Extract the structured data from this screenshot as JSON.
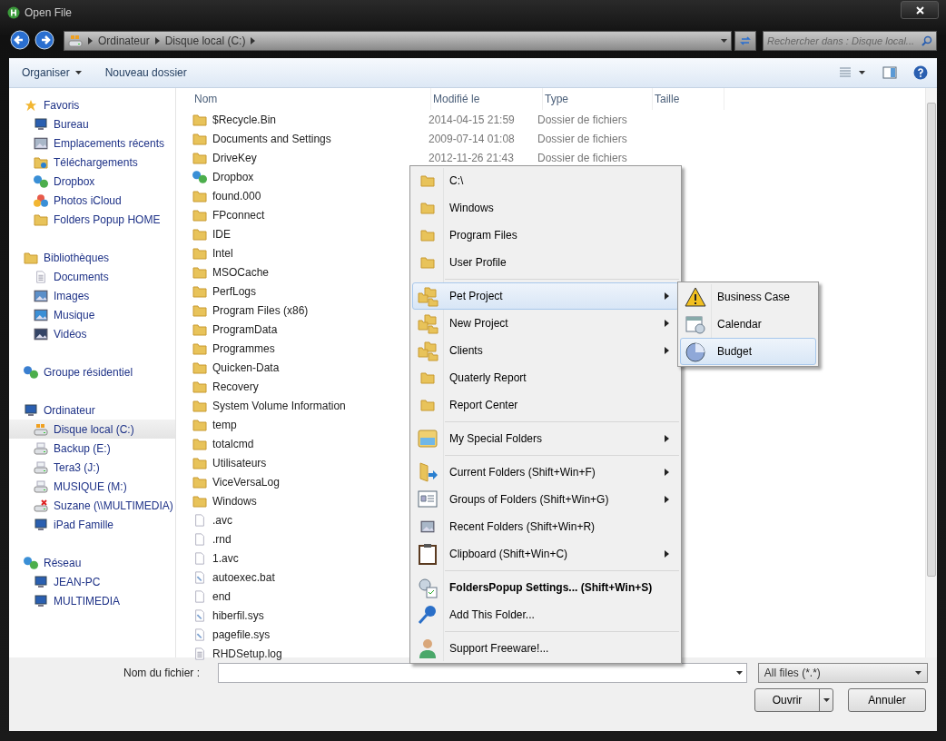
{
  "window": {
    "title": "Open File"
  },
  "address_bar": {
    "crumbs": [
      "Ordinateur",
      "Disque local (C:)"
    ]
  },
  "search": {
    "placeholder": "Rechercher dans : Disque local..."
  },
  "toolbar": {
    "items": [
      {
        "label": "Organiser",
        "dropdown": true
      },
      {
        "label": "Nouveau dossier",
        "dropdown": false
      }
    ]
  },
  "sidebar": {
    "groups": [
      {
        "label": "Favoris",
        "kind": "star",
        "children": [
          {
            "label": "Bureau",
            "kind": "desktop",
            "selected": false
          },
          {
            "label": "Emplacements récents",
            "kind": "recent",
            "selected": false
          },
          {
            "label": "Téléchargements",
            "kind": "download",
            "selected": false
          },
          {
            "label": "Dropbox",
            "kind": "dropbox",
            "selected": false
          },
          {
            "label": "Photos iCloud",
            "kind": "photos",
            "selected": false
          },
          {
            "label": "Folders Popup HOME",
            "kind": "folder",
            "selected": false
          }
        ]
      },
      {
        "label": "Bibliothèques",
        "kind": "library",
        "children": [
          {
            "label": "Documents",
            "kind": "document",
            "selected": false
          },
          {
            "label": "Images",
            "kind": "image",
            "selected": false
          },
          {
            "label": "Musique",
            "kind": "music",
            "selected": false
          },
          {
            "label": "Vidéos",
            "kind": "video",
            "selected": false
          }
        ]
      },
      {
        "label": "Groupe résidentiel",
        "kind": "homegroup"
      },
      {
        "label": "Ordinateur",
        "kind": "computer",
        "children": [
          {
            "label": "Disque local (C:)",
            "kind": "drive-os",
            "selected": true
          },
          {
            "label": "Backup (E:)",
            "kind": "drive",
            "selected": false
          },
          {
            "label": "Tera3 (J:)",
            "kind": "drive",
            "selected": false
          },
          {
            "label": "MUSIQUE (M:)",
            "kind": "drive",
            "selected": false
          },
          {
            "label": "Suzane (\\\\MULTIMEDIA)",
            "kind": "netdrive",
            "selected": false
          },
          {
            "label": "iPad Famille",
            "kind": "device",
            "selected": false
          }
        ]
      },
      {
        "label": "Réseau",
        "kind": "network",
        "children": [
          {
            "label": "JEAN-PC",
            "kind": "computer",
            "selected": false
          },
          {
            "label": "MULTIMEDIA",
            "kind": "computer",
            "selected": false
          }
        ]
      }
    ]
  },
  "file_list": {
    "columns": [
      "Nom",
      "Modifié le",
      "Type",
      "Taille"
    ],
    "rows": [
      {
        "name": "$Recycle.Bin",
        "kind": "folder",
        "modified": "2014-04-15 21:59",
        "type": "Dossier de fichiers"
      },
      {
        "name": "Documents and Settings",
        "kind": "folder",
        "modified": "2009-07-14 01:08",
        "type": "Dossier de fichiers"
      },
      {
        "name": "DriveKey",
        "kind": "folder",
        "modified": "2012-11-26 21:43",
        "type": "Dossier de fichiers"
      },
      {
        "name": "Dropbox",
        "kind": "dropbox"
      },
      {
        "name": "found.000",
        "kind": "folder"
      },
      {
        "name": "FPconnect",
        "kind": "folder"
      },
      {
        "name": "IDE",
        "kind": "folder"
      },
      {
        "name": "Intel",
        "kind": "folder"
      },
      {
        "name": "MSOCache",
        "kind": "folder"
      },
      {
        "name": "PerfLogs",
        "kind": "folder"
      },
      {
        "name": "Program Files (x86)",
        "kind": "folder"
      },
      {
        "name": "ProgramData",
        "kind": "folder"
      },
      {
        "name": "Programmes",
        "kind": "folder"
      },
      {
        "name": "Quicken-Data",
        "kind": "folder"
      },
      {
        "name": "Recovery",
        "kind": "folder"
      },
      {
        "name": "System Volume Information",
        "kind": "folder"
      },
      {
        "name": "temp",
        "kind": "folder"
      },
      {
        "name": "totalcmd",
        "kind": "folder"
      },
      {
        "name": "Utilisateurs",
        "kind": "folder"
      },
      {
        "name": "ViceVersaLog",
        "kind": "folder"
      },
      {
        "name": "Windows",
        "kind": "folder"
      },
      {
        "name": ".avc",
        "kind": "file"
      },
      {
        "name": ".rnd",
        "kind": "file"
      },
      {
        "name": "1.avc",
        "kind": "file"
      },
      {
        "name": "autoexec.bat",
        "kind": "system-file"
      },
      {
        "name": "end",
        "kind": "file"
      },
      {
        "name": "hiberfil.sys",
        "kind": "system-file"
      },
      {
        "name": "pagefile.sys",
        "kind": "system-file"
      },
      {
        "name": "RHDSetup.log",
        "kind": "text-file"
      }
    ]
  },
  "file_name": {
    "label": "Nom du fichier :"
  },
  "file_type": {
    "value": "All files (*.*)"
  },
  "buttons": [
    {
      "label": "Ouvrir",
      "split": true
    },
    {
      "label": "Annuler",
      "split": false
    }
  ],
  "popup_menu": {
    "sections": [
      [
        {
          "label": "C:\\",
          "kind": "folder",
          "submenu": false,
          "selected": false,
          "bold": false
        },
        {
          "label": "Windows",
          "kind": "folder",
          "submenu": false,
          "selected": false,
          "bold": false
        },
        {
          "label": "Program Files",
          "kind": "folder",
          "submenu": false,
          "selected": false,
          "bold": false
        },
        {
          "label": "User Profile",
          "kind": "folder",
          "submenu": false,
          "selected": false,
          "bold": false
        }
      ],
      [
        {
          "label": "Pet Project",
          "kind": "folders",
          "submenu": true,
          "selected": true,
          "bold": false
        },
        {
          "label": "New Project",
          "kind": "folders",
          "submenu": true,
          "selected": false,
          "bold": false
        },
        {
          "label": "Clients",
          "kind": "folders",
          "submenu": true,
          "selected": false,
          "bold": false
        },
        {
          "label": "Quaterly Report",
          "kind": "folder",
          "submenu": false,
          "selected": false,
          "bold": false
        },
        {
          "label": "Report Center",
          "kind": "folder",
          "submenu": false,
          "selected": false,
          "bold": false
        }
      ],
      [
        {
          "label": "My Special Folders",
          "kind": "special",
          "submenu": true,
          "selected": false,
          "bold": false
        }
      ],
      [
        {
          "label": "Current Folders (Shift+Win+F)",
          "kind": "folder-arrow",
          "submenu": true,
          "selected": false,
          "bold": false
        },
        {
          "label": "Groups of Folders (Shift+Win+G)",
          "kind": "group",
          "submenu": true,
          "selected": false,
          "bold": false
        },
        {
          "label": "Recent Folders (Shift+Win+R)",
          "kind": "recent",
          "submenu": false,
          "selected": false,
          "bold": false
        },
        {
          "label": "Clipboard (Shift+Win+C)",
          "kind": "clipboard",
          "submenu": true,
          "selected": false,
          "bold": false
        }
      ],
      [
        {
          "label": "FoldersPopup Settings... (Shift+Win+S)",
          "kind": "settings",
          "submenu": false,
          "selected": false,
          "bold": true
        },
        {
          "label": "Add This Folder...",
          "kind": "pin",
          "submenu": false,
          "selected": false,
          "bold": false
        }
      ],
      [
        {
          "label": "Support Freeware!...",
          "kind": "person",
          "submenu": false,
          "selected": false,
          "bold": false
        }
      ]
    ]
  },
  "submenu": {
    "items": [
      {
        "label": "Business Case",
        "kind": "warning",
        "selected": false
      },
      {
        "label": "Calendar",
        "kind": "calendar",
        "selected": false
      },
      {
        "label": "Budget",
        "kind": "chart",
        "selected": true
      }
    ]
  }
}
